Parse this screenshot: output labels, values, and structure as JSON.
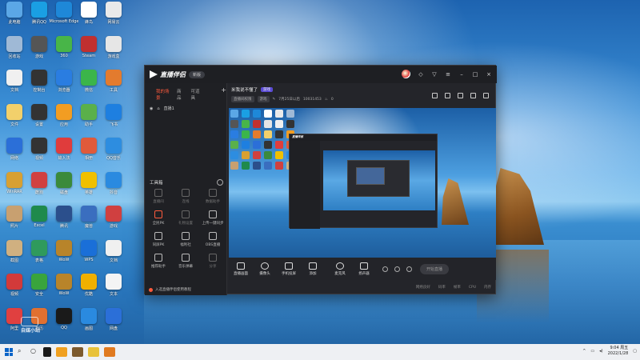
{
  "desktop": {
    "icons": [
      {
        "label": "此电脑",
        "color": "#5ba7e6"
      },
      {
        "label": "腾讯QQ",
        "color": "#1a9fe3"
      },
      {
        "label": "Microsoft Edge",
        "color": "#1e88d8"
      },
      {
        "label": "蜂鸟",
        "color": "#ffffff"
      },
      {
        "label": "网易云",
        "color": "#eaeaea"
      },
      {
        "label": "回收站",
        "color": "#9fb9d6"
      },
      {
        "label": "游戏",
        "color": "#555"
      },
      {
        "label": "360",
        "color": "#48b548"
      },
      {
        "label": "Steam",
        "color": "#c03030"
      },
      {
        "label": "游戏盒",
        "color": "#e6e6e6"
      },
      {
        "label": "文档",
        "color": "#f0f0f0"
      },
      {
        "label": "控制台",
        "color": "#333"
      },
      {
        "label": "浏览器",
        "color": "#2a7de1"
      },
      {
        "label": "微信",
        "color": "#3bb54a"
      },
      {
        "label": "工具",
        "color": "#e37b2e"
      },
      {
        "label": "文件",
        "color": "#f2d06b"
      },
      {
        "label": "设置",
        "color": "#333"
      },
      {
        "label": "应用",
        "color": "#f29d22"
      },
      {
        "label": "助手",
        "color": "#5ab04a"
      },
      {
        "label": "飞书",
        "color": "#1e7fe0"
      },
      {
        "label": "网络",
        "color": "#2b6fd8"
      },
      {
        "label": "视频",
        "color": "#333"
      },
      {
        "label": "输入法",
        "color": "#e03c3c"
      },
      {
        "label": "相册",
        "color": "#e05a3a"
      },
      {
        "label": "QQ音乐",
        "color": "#2d8de0"
      },
      {
        "label": "WinRAR",
        "color": "#d8a032"
      },
      {
        "label": "酷狗",
        "color": "#d04040"
      },
      {
        "label": "磁盘",
        "color": "#3b8a3b"
      },
      {
        "label": "英雄",
        "color": "#f0c000"
      },
      {
        "label": "抖音",
        "color": "#2a8ae0"
      },
      {
        "label": "照片",
        "color": "#c8a070"
      },
      {
        "label": "Excel",
        "color": "#1f8a4c"
      },
      {
        "label": "腾讯",
        "color": "#2b4f8c"
      },
      {
        "label": "魔兽",
        "color": "#3a6ebf"
      },
      {
        "label": "游戏",
        "color": "#d04040"
      },
      {
        "label": "截图",
        "color": "#d0b080"
      },
      {
        "label": "表格",
        "color": "#2f9a5c"
      },
      {
        "label": "WoW",
        "color": "#b8842a"
      },
      {
        "label": "WPS",
        "color": "#1a6fd8"
      },
      {
        "label": "文档",
        "color": "#f0f0f0"
      },
      {
        "label": "视频",
        "color": "#d23a3a"
      },
      {
        "label": "安全",
        "color": "#39a43c"
      },
      {
        "label": "WoW",
        "color": "#b8842a"
      },
      {
        "label": "优酷",
        "color": "#f0b000"
      },
      {
        "label": "文本",
        "color": "#f4f4f4"
      },
      {
        "label": "阿里",
        "color": "#e04040"
      },
      {
        "label": "日历",
        "color": "#e07030"
      },
      {
        "label": "QQ",
        "color": "#1a1a1a"
      },
      {
        "label": "画图",
        "color": "#2a8ae0"
      },
      {
        "label": "网盘",
        "color": "#2b6fd8"
      }
    ]
  },
  "window": {
    "app_name": "直播伴侣",
    "version_pill": "新版",
    "left_tabs": [
      "我的场景",
      "商品",
      "可道具"
    ],
    "scene_label": "直播1",
    "tools_title": "工具箱",
    "tools": [
      {
        "label": "直播间",
        "dim": true
      },
      {
        "label": "连线",
        "dim": true
      },
      {
        "label": "数据助手",
        "dim": true
      },
      {
        "label": "全民PK",
        "red": true
      },
      {
        "label": "礼物设置",
        "dim": true
      },
      {
        "label": "上传一键同步",
        "dim": false
      },
      {
        "label": "同屏PK",
        "dim": false
      },
      {
        "label": "福利社",
        "dim": false
      },
      {
        "label": "OBS直播",
        "dim": false
      },
      {
        "label": "推荐助手",
        "dim": false
      },
      {
        "label": "音乐弹幕",
        "dim": false
      },
      {
        "label": "分享",
        "dim": true
      }
    ],
    "left_footer": "入选直播伴侣使用教程",
    "room_title": "米我说不懂了",
    "room_tag": "游戏",
    "meta_chips": [
      "直播间权限",
      "游戏"
    ],
    "meta_text_1": "7月25日以后",
    "meta_text_2": "10031453",
    "meta_text_3": "0",
    "controls": [
      "直播画面",
      "摄像头",
      "手机投屏",
      "添加",
      "麦克风",
      "扬声器"
    ],
    "start_label": "开始直播",
    "status_items": [
      "网络良好",
      "码率",
      "帧率",
      "CPU",
      "内存"
    ]
  },
  "taskbar": {
    "time": "9:04 周五",
    "date": "2022/1/28"
  },
  "watermark": {
    "label": "自媒小站"
  }
}
